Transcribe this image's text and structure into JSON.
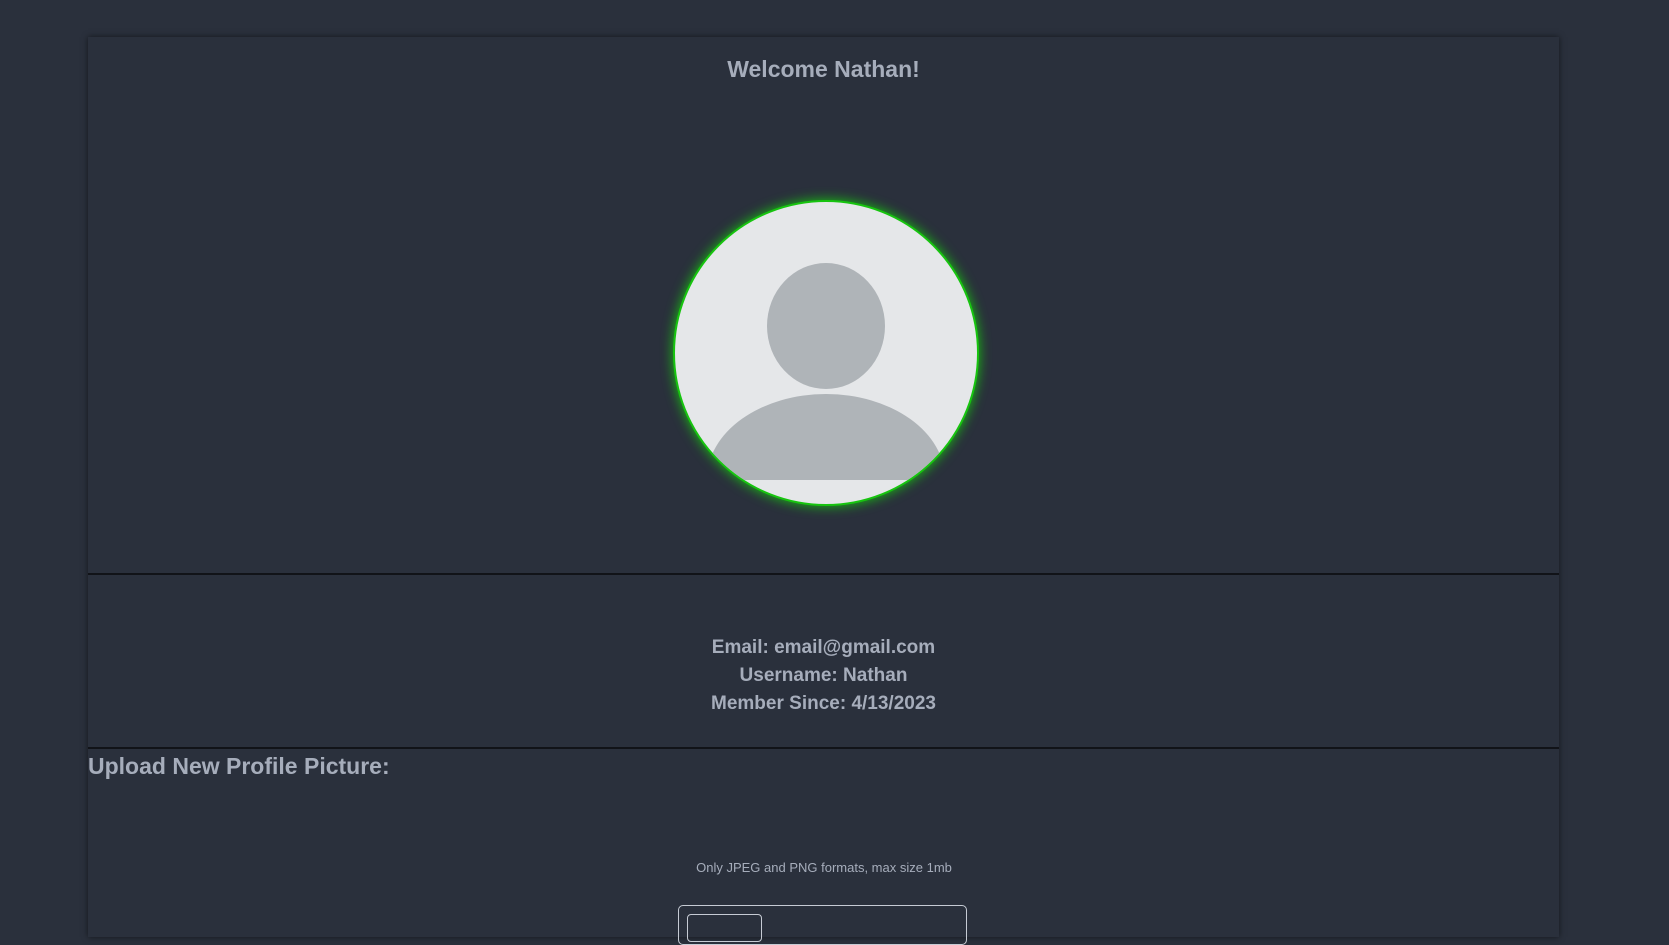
{
  "profile": {
    "welcome": "Welcome Nathan!",
    "avatar_icon": "default-user-icon",
    "avatar_ring_color": "#17c40f"
  },
  "info": {
    "email": "Email: email@gmail.com",
    "username": "Username: Nathan",
    "member_since": "Member Since: 4/13/2023"
  },
  "upload": {
    "title": "Upload New Profile Picture:",
    "hint": "Only JPEG and PNG formats, max size 1mb"
  },
  "colors": {
    "background": "#2a303c",
    "text": "#a6adbb"
  }
}
